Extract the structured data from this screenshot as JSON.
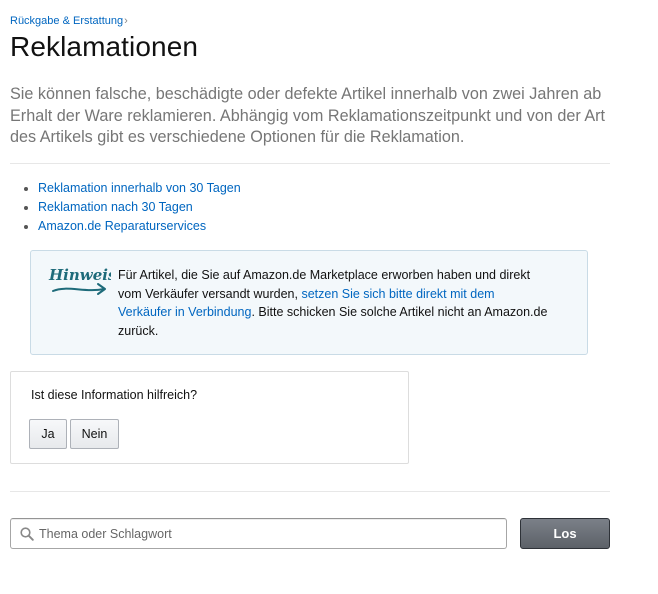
{
  "breadcrumb": {
    "label": "Rückgabe & Erstattung",
    "separator": "›"
  },
  "page": {
    "title": "Reklamationen",
    "intro": "Sie können falsche, beschädigte oder defekte Artikel innerhalb von zwei Jahren ab Erhalt der Ware reklamieren. Abhängig vom Reklamationszeitpunkt und von der Art des Artikels gibt es verschiedene Optionen für die Reklamation."
  },
  "links": [
    {
      "label": "Reklamation innerhalb von 30 Tagen"
    },
    {
      "label": "Reklamation nach 30 Tagen"
    },
    {
      "label": "Amazon.de Reparaturservices"
    }
  ],
  "notice": {
    "icon_label": "Hinweis",
    "text_before": "Für Artikel, die Sie auf Amazon.de Marketplace erworben haben und direkt vom Verkäufer versandt wurden, ",
    "link": "setzen Sie sich bitte direkt mit dem Verkäufer in Verbindung",
    "text_after": ". Bitte schicken Sie solche Artikel nicht an Amazon.de zurück.",
    "color": "#1e6b7a"
  },
  "feedback": {
    "question": "Ist diese Information hilfreich?",
    "yes_label": "Ja",
    "no_label": "Nein"
  },
  "search": {
    "placeholder": "Thema oder Schlagwort",
    "value": "",
    "button_label": "Los"
  },
  "colors": {
    "link": "#0066c0",
    "intro_text": "#767676",
    "notice_background": "#f3f8fb",
    "search_button": "#5c6168"
  }
}
